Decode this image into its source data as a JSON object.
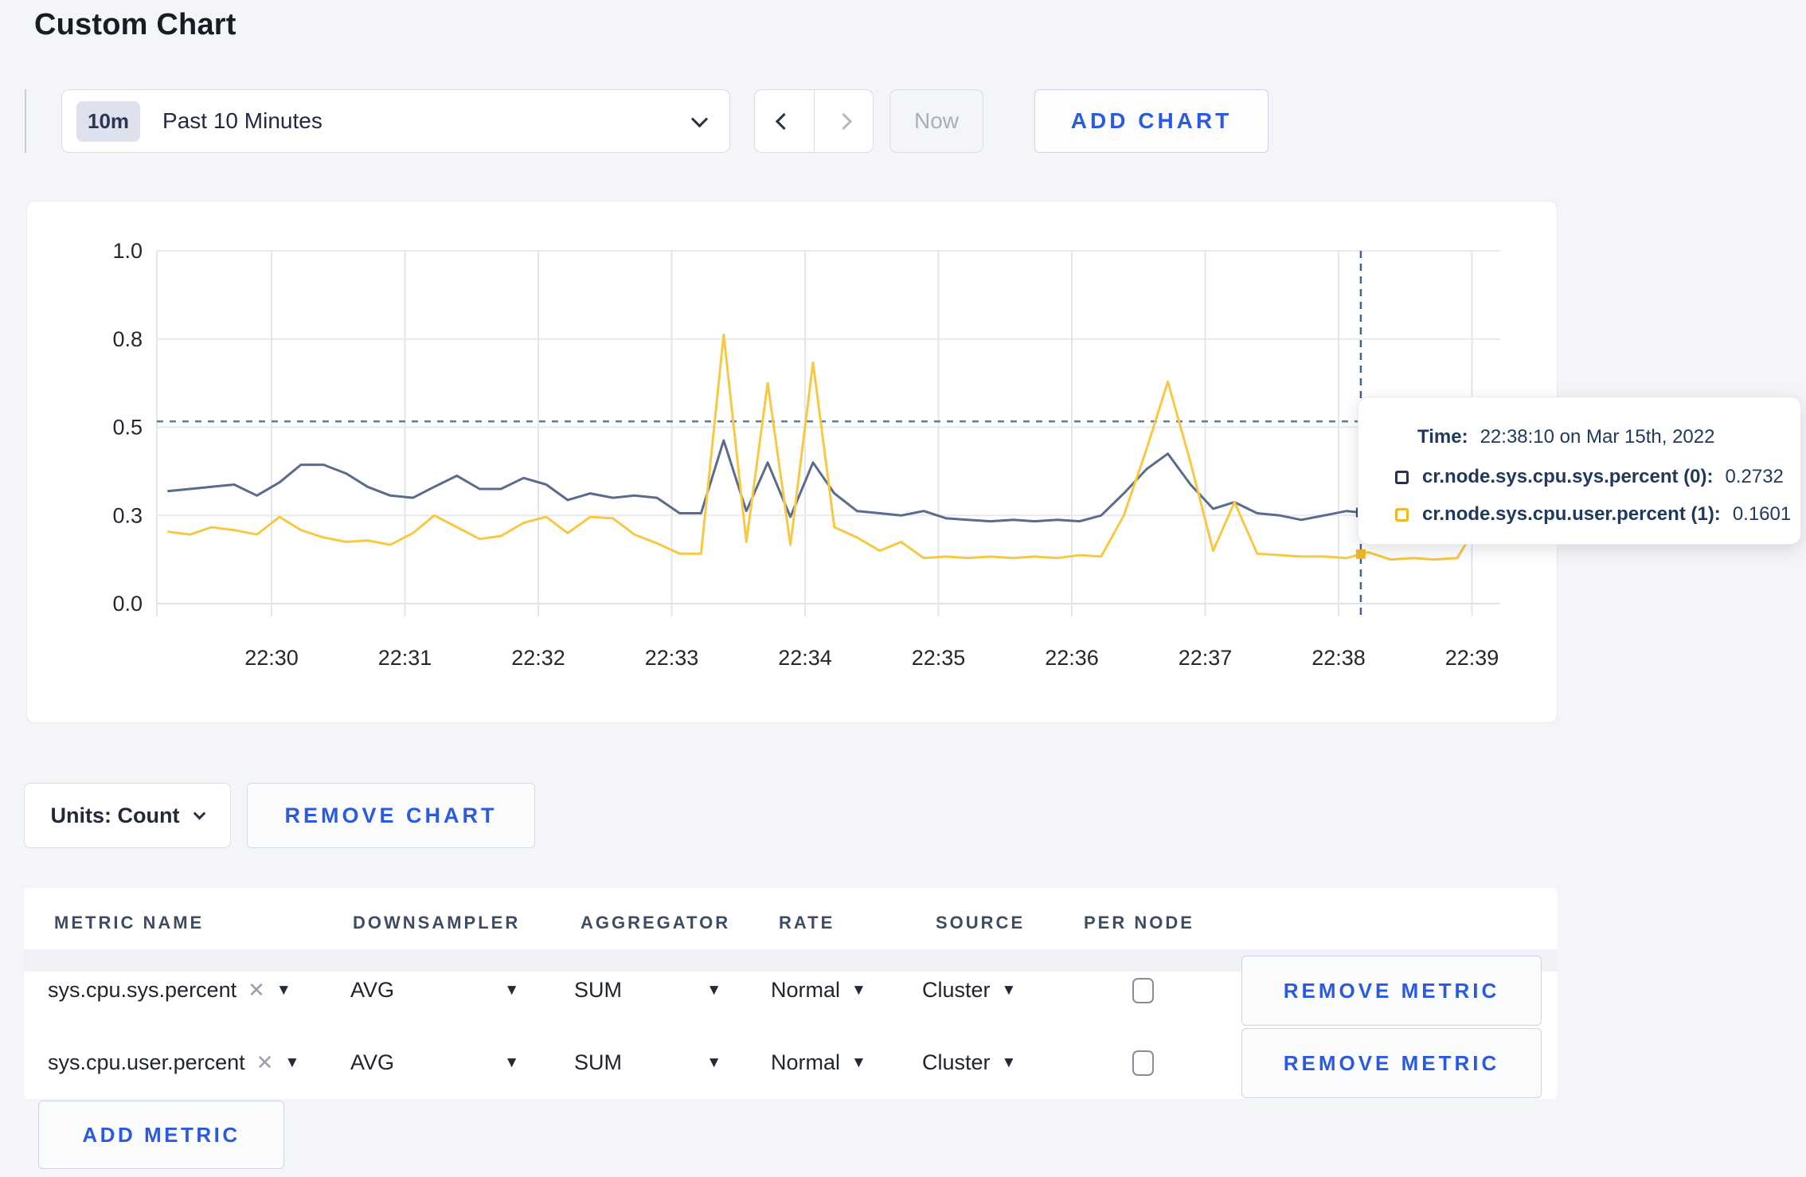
{
  "page": {
    "title": "Custom Chart",
    "background": "#f4f5f9",
    "accent_blue": "#2b59e0"
  },
  "toolbar": {
    "time_range_badge": "10m",
    "time_range_label": "Past 10 Minutes",
    "now_label": "Now",
    "add_chart_label": "ADD CHART"
  },
  "chart_controls": {
    "units_label": "Units: Count",
    "remove_chart_label": "REMOVE CHART"
  },
  "tooltip": {
    "time_label": "Time:",
    "time_value": "22:38:10 on Mar 15th, 2022",
    "series": [
      {
        "label": "cr.node.sys.cpu.sys.percent (0):",
        "value": "0.2732",
        "swatch_color": "#26334d"
      },
      {
        "label": "cr.node.sys.cpu.user.percent (1):",
        "value": "0.1601",
        "swatch_color": "#f2b824"
      }
    ]
  },
  "chart_data": {
    "type": "line",
    "title": "",
    "xlabel": "",
    "ylabel": "",
    "x_ticks": [
      "22:30",
      "22:31",
      "22:32",
      "22:33",
      "22:34",
      "22:35",
      "22:36",
      "22:37",
      "22:38",
      "22:39"
    ],
    "y_ticks": [
      1.0,
      0.8,
      0.5,
      0.3,
      0.0
    ],
    "y_tick_labels": [
      "1.0",
      "0.8",
      "0.5",
      "0.3",
      "0.0"
    ],
    "grid": true,
    "legend_position": "tooltip-only",
    "threshold_dashed_value": 0.52,
    "crosshair": {
      "t_minutes_from_2230": 8.1667,
      "time": "22:38:10"
    },
    "x_unit": "minutes relative to 22:30, sampled every 10s",
    "series": [
      {
        "name": "cr.node.sys.cpu.sys.percent",
        "color": "#5b6b8c",
        "points": [
          [
            -0.78,
            0.355
          ],
          [
            -0.61,
            0.36
          ],
          [
            -0.45,
            0.365
          ],
          [
            -0.28,
            0.37
          ],
          [
            -0.11,
            0.345
          ],
          [
            0.06,
            0.375
          ],
          [
            0.22,
            0.415
          ],
          [
            0.39,
            0.415
          ],
          [
            0.56,
            0.395
          ],
          [
            0.72,
            0.365
          ],
          [
            0.89,
            0.345
          ],
          [
            1.06,
            0.34
          ],
          [
            1.22,
            0.365
          ],
          [
            1.39,
            0.39
          ],
          [
            1.56,
            0.36
          ],
          [
            1.72,
            0.36
          ],
          [
            1.89,
            0.385
          ],
          [
            2.06,
            0.37
          ],
          [
            2.22,
            0.335
          ],
          [
            2.39,
            0.35
          ],
          [
            2.56,
            0.34
          ],
          [
            2.72,
            0.345
          ],
          [
            2.89,
            0.34
          ],
          [
            3.06,
            0.305
          ],
          [
            3.22,
            0.305
          ],
          [
            3.39,
            0.47
          ],
          [
            3.56,
            0.31
          ],
          [
            3.72,
            0.42
          ],
          [
            3.89,
            0.295
          ],
          [
            4.06,
            0.42
          ],
          [
            4.22,
            0.35
          ],
          [
            4.39,
            0.31
          ],
          [
            4.56,
            0.305
          ],
          [
            4.72,
            0.3
          ],
          [
            4.89,
            0.31
          ],
          [
            5.06,
            0.29
          ],
          [
            5.22,
            0.285
          ],
          [
            5.39,
            0.28
          ],
          [
            5.56,
            0.285
          ],
          [
            5.72,
            0.28
          ],
          [
            5.89,
            0.285
          ],
          [
            6.06,
            0.28
          ],
          [
            6.22,
            0.3
          ],
          [
            6.39,
            0.35
          ],
          [
            6.56,
            0.405
          ],
          [
            6.72,
            0.44
          ],
          [
            6.89,
            0.37
          ],
          [
            7.06,
            0.315
          ],
          [
            7.22,
            0.33
          ],
          [
            7.39,
            0.305
          ],
          [
            7.56,
            0.3
          ],
          [
            7.72,
            0.285
          ],
          [
            7.89,
            0.3
          ],
          [
            8.06,
            0.31
          ],
          [
            8.22,
            0.305
          ],
          [
            8.39,
            0.285
          ],
          [
            8.56,
            0.275
          ],
          [
            8.72,
            0.28
          ],
          [
            8.89,
            0.285
          ],
          [
            9.06,
            0.31
          ],
          [
            9.2,
            0.305
          ]
        ]
      },
      {
        "name": "cr.node.sys.cpu.user.percent",
        "color": "#f7c843",
        "points": [
          [
            -0.78,
            0.245
          ],
          [
            -0.61,
            0.235
          ],
          [
            -0.45,
            0.26
          ],
          [
            -0.28,
            0.25
          ],
          [
            -0.11,
            0.235
          ],
          [
            0.06,
            0.295
          ],
          [
            0.22,
            0.25
          ],
          [
            0.39,
            0.225
          ],
          [
            0.56,
            0.21
          ],
          [
            0.72,
            0.215
          ],
          [
            0.89,
            0.2
          ],
          [
            1.06,
            0.24
          ],
          [
            1.22,
            0.3
          ],
          [
            1.39,
            0.26
          ],
          [
            1.56,
            0.22
          ],
          [
            1.72,
            0.23
          ],
          [
            1.89,
            0.275
          ],
          [
            2.06,
            0.295
          ],
          [
            2.22,
            0.24
          ],
          [
            2.39,
            0.295
          ],
          [
            2.56,
            0.29
          ],
          [
            2.72,
            0.235
          ],
          [
            2.89,
            0.205
          ],
          [
            3.06,
            0.17
          ],
          [
            3.22,
            0.17
          ],
          [
            3.39,
            0.81
          ],
          [
            3.56,
            0.21
          ],
          [
            3.72,
            0.65
          ],
          [
            3.89,
            0.2
          ],
          [
            4.06,
            0.72
          ],
          [
            4.22,
            0.26
          ],
          [
            4.39,
            0.225
          ],
          [
            4.56,
            0.18
          ],
          [
            4.72,
            0.21
          ],
          [
            4.89,
            0.155
          ],
          [
            5.06,
            0.16
          ],
          [
            5.22,
            0.155
          ],
          [
            5.39,
            0.16
          ],
          [
            5.56,
            0.155
          ],
          [
            5.72,
            0.16
          ],
          [
            5.89,
            0.155
          ],
          [
            6.06,
            0.165
          ],
          [
            6.22,
            0.16
          ],
          [
            6.39,
            0.3
          ],
          [
            6.56,
            0.45
          ],
          [
            6.72,
            0.655
          ],
          [
            6.89,
            0.42
          ],
          [
            7.06,
            0.18
          ],
          [
            7.22,
            0.33
          ],
          [
            7.39,
            0.17
          ],
          [
            7.56,
            0.165
          ],
          [
            7.72,
            0.16
          ],
          [
            7.89,
            0.16
          ],
          [
            8.06,
            0.155
          ],
          [
            8.22,
            0.175
          ],
          [
            8.39,
            0.15
          ],
          [
            8.56,
            0.155
          ],
          [
            8.72,
            0.15
          ],
          [
            8.89,
            0.155
          ],
          [
            9.06,
            0.285
          ],
          [
            9.2,
            0.24
          ]
        ]
      }
    ]
  },
  "metrics_table": {
    "headers": [
      "METRIC NAME",
      "DOWNSAMPLER",
      "AGGREGATOR",
      "RATE",
      "SOURCE",
      "PER NODE"
    ],
    "rows": [
      {
        "metric_name": "sys.cpu.sys.percent",
        "downsampler": "AVG",
        "aggregator": "SUM",
        "rate": "Normal",
        "source": "Cluster",
        "per_node_checked": false,
        "remove_label": "REMOVE METRIC"
      },
      {
        "metric_name": "sys.cpu.user.percent",
        "downsampler": "AVG",
        "aggregator": "SUM",
        "rate": "Normal",
        "source": "Cluster",
        "per_node_checked": false,
        "remove_label": "REMOVE METRIC"
      }
    ],
    "add_metric_label": "ADD METRIC",
    "close_glyph": "✕",
    "caret_glyph": "▼"
  }
}
